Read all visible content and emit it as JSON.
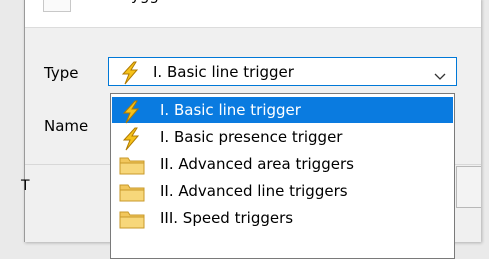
{
  "dialog": {
    "title_fragment": "ygg",
    "type_label": "Type",
    "name_label": "Name",
    "background_fragment": "T"
  },
  "combo": {
    "selected_text": "I. Basic line trigger",
    "selected_icon": "lightning-icon"
  },
  "dropdown": {
    "items": [
      {
        "label": "I. Basic line trigger",
        "icon": "lightning-icon",
        "selected": true
      },
      {
        "label": "I. Basic presence trigger",
        "icon": "lightning-icon",
        "selected": false
      },
      {
        "label": "II. Advanced area triggers",
        "icon": "folder-icon",
        "selected": false
      },
      {
        "label": "II. Advanced line triggers",
        "icon": "folder-icon",
        "selected": false
      },
      {
        "label": "III. Speed triggers",
        "icon": "folder-icon",
        "selected": false
      }
    ]
  },
  "colors": {
    "selection": "#0a7be0",
    "focus_border": "#0078d7",
    "lightning_fill": "#f6c21a",
    "folder_fill": "#f2c75c"
  }
}
